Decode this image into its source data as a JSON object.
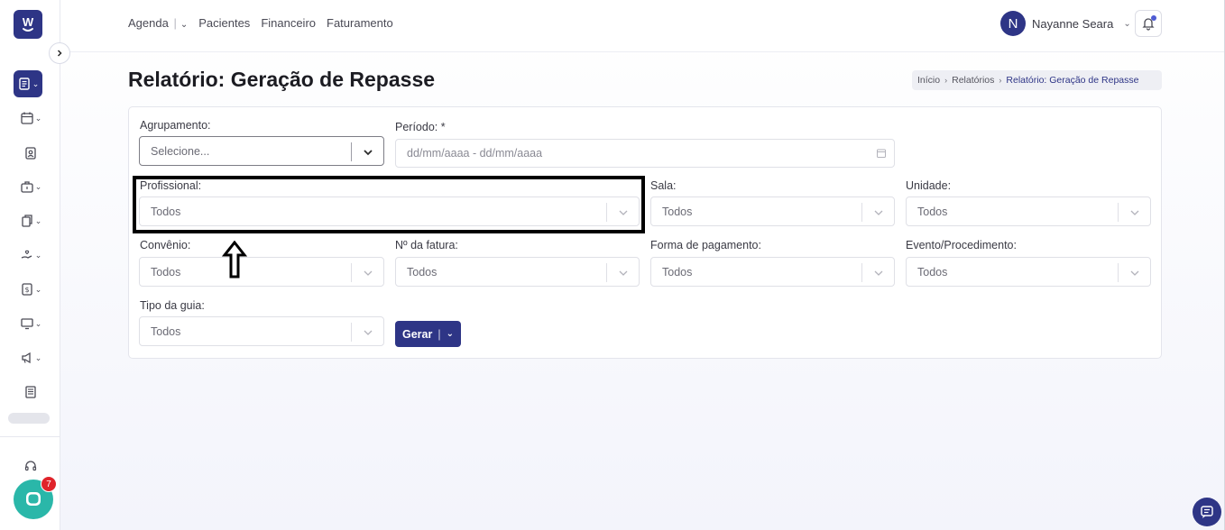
{
  "app": {
    "logo_letter": "W"
  },
  "topnav": {
    "agenda": "Agenda",
    "pacientes": "Pacientes",
    "financeiro": "Financeiro",
    "faturamento": "Faturamento"
  },
  "user": {
    "initial": "N",
    "name": "Nayanne Seara"
  },
  "chat": {
    "badge_count": "7"
  },
  "page": {
    "title": "Relatório: Geração de Repasse"
  },
  "breadcrumb": {
    "home": "Início",
    "reports": "Relatórios",
    "current": "Relatório: Geração de Repasse"
  },
  "form": {
    "agrupamento": {
      "label": "Agrupamento:",
      "value": "Selecione..."
    },
    "periodo": {
      "label": "Período: *",
      "placeholder": "dd/mm/aaaa - dd/mm/aaaa"
    },
    "profissional": {
      "label": "Profissional:",
      "value": "Todos"
    },
    "sala": {
      "label": "Sala:",
      "value": "Todos"
    },
    "unidade": {
      "label": "Unidade:",
      "value": "Todos"
    },
    "convenio": {
      "label": "Convênio:",
      "value": "Todos"
    },
    "fatura": {
      "label": "Nº da fatura:",
      "value": "Todos"
    },
    "pagamento": {
      "label": "Forma de pagamento:",
      "value": "Todos"
    },
    "evento": {
      "label": "Evento/Procedimento:",
      "value": "Todos"
    },
    "tipo_guia": {
      "label": "Tipo da guia:",
      "value": "Todos"
    },
    "gerar_label": "Gerar"
  }
}
